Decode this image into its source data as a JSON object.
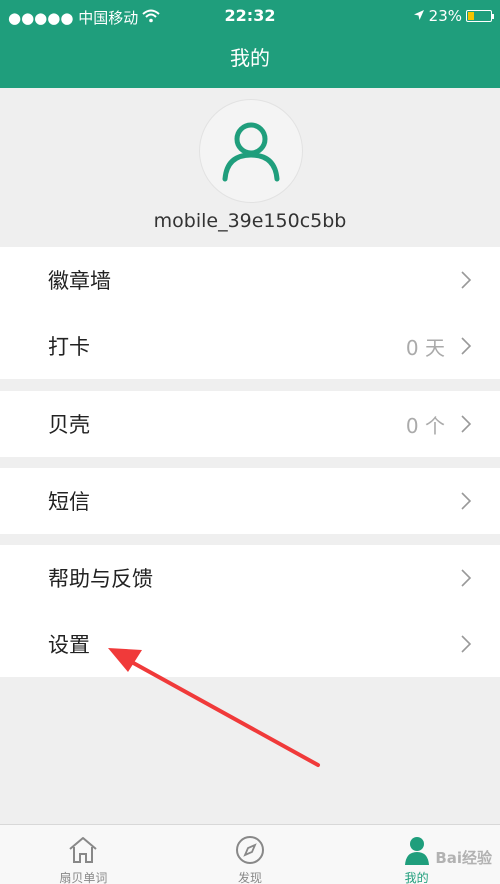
{
  "status_bar": {
    "carrier": "●●●●● 中国移动",
    "time": "22:32",
    "battery": "23%",
    "battery_level": 0.23
  },
  "nav": {
    "title": "我的"
  },
  "profile": {
    "username": "mobile_39e150c5bb"
  },
  "menu": {
    "badge_wall": "徽章墙",
    "checkin": "打卡",
    "checkin_value": "0 天",
    "shells": "贝壳",
    "shells_value": "0 个",
    "sms": "短信",
    "help": "帮助与反馈",
    "settings": "设置"
  },
  "tabbar": {
    "tab1": "扇贝单词",
    "tab2": "发现",
    "tab3": "我的"
  },
  "colors": {
    "brand": "#1f9e7c",
    "annotation": "#f03a3a"
  },
  "watermark": "Bai经验"
}
